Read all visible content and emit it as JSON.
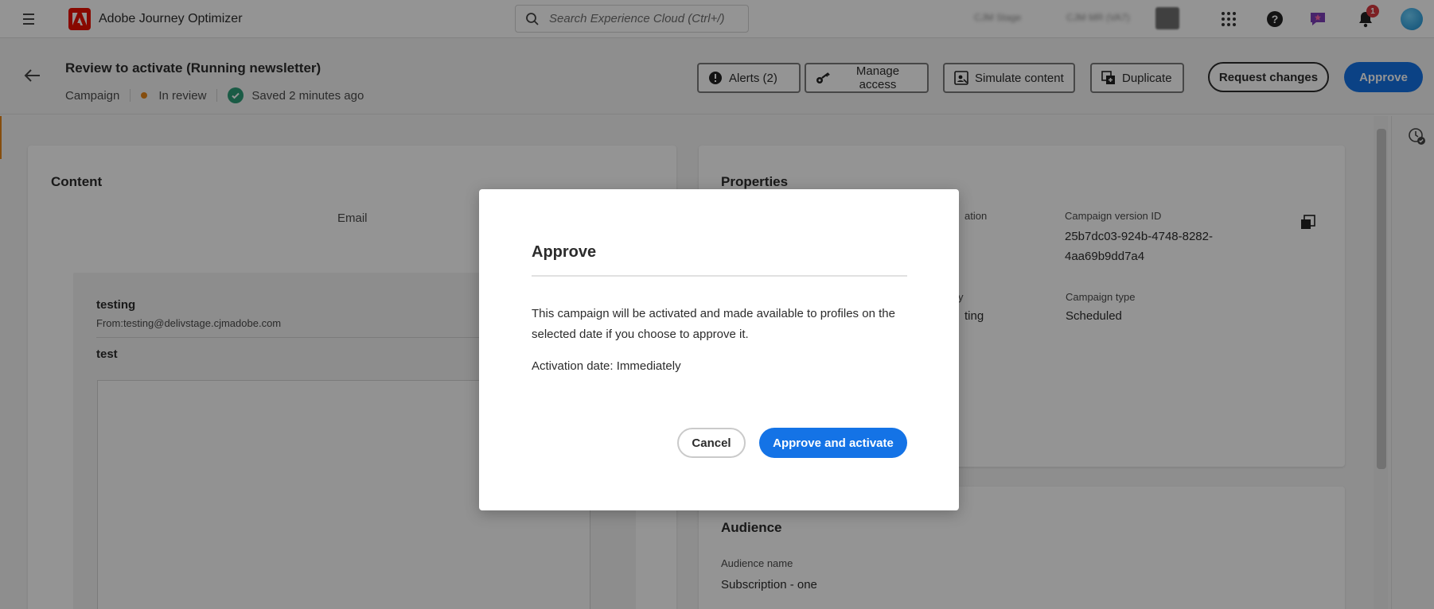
{
  "shell": {
    "app_title": "Adobe Journey Optimizer",
    "search_placeholder": "Search Experience Cloud (Ctrl+/)",
    "org_blurred_1": "CJM Stage",
    "org_blurred_2": "CJM MR (VA7)",
    "notification_count": "1",
    "icons": [
      "menu-icon",
      "adobe-logo",
      "search-icon",
      "apps-icon",
      "help-icon",
      "feedback-icon",
      "bell-icon",
      "avatar"
    ]
  },
  "header": {
    "title": "Review to activate (Running newsletter)",
    "type": "Campaign",
    "status": "In review",
    "saved": "Saved 2 minutes ago",
    "buttons": {
      "alerts": "Alerts (2)",
      "manage_access": "Manage access",
      "simulate": "Simulate content",
      "duplicate": "Duplicate",
      "request_changes": "Request changes",
      "approve": "Approve"
    }
  },
  "content": {
    "title": "Content",
    "channel": "Email",
    "sender_name": "testing",
    "sender_from": "From:testing@delivstage.cjmadobe.com",
    "subject": "test"
  },
  "properties": {
    "title": "Properties",
    "partial_label_1": "ation",
    "partial_label_2": "y",
    "partial_value_2": "ting",
    "version_label": "Campaign version ID",
    "version_line1": "25b7dc03-924b-4748-8282-",
    "version_line2": "4aa69b9dd7a4",
    "type_label": "Campaign type",
    "type_value": "Scheduled"
  },
  "audience": {
    "title": "Audience",
    "name_label": "Audience name",
    "name_value": "Subscription - one"
  },
  "dialog": {
    "title": "Approve",
    "message": "This campaign will be activated and made available to profiles on the selected date if you choose to approve it.",
    "activation": "Activation date: Immediately",
    "cancel": "Cancel",
    "confirm": "Approve and activate"
  },
  "colors": {
    "accent_blue": "#1473e6",
    "adobe_red": "#eb1000",
    "status_orange": "#e68619",
    "saved_green": "#2d9d78"
  }
}
